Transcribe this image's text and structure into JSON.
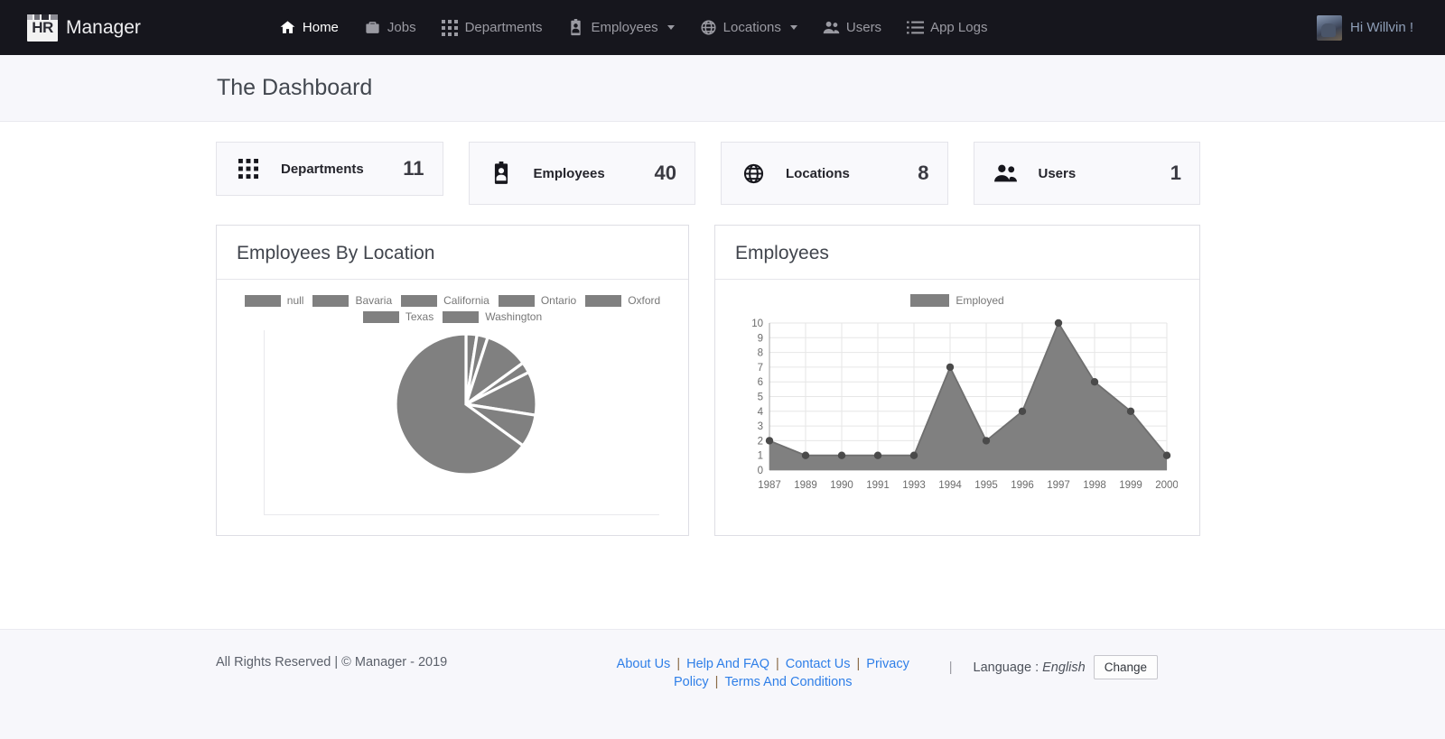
{
  "navbar": {
    "brand_logo_text": "HR",
    "brand_name": "Manager",
    "items": [
      {
        "label": "Home",
        "icon": "home-icon",
        "active": true,
        "caret": false
      },
      {
        "label": "Jobs",
        "icon": "briefcase-icon",
        "active": false,
        "caret": false
      },
      {
        "label": "Departments",
        "icon": "grid-icon",
        "active": false,
        "caret": false
      },
      {
        "label": "Employees",
        "icon": "id-badge-icon",
        "active": false,
        "caret": true
      },
      {
        "label": "Locations",
        "icon": "globe-icon",
        "active": false,
        "caret": true
      },
      {
        "label": "Users",
        "icon": "people-icon",
        "active": false,
        "caret": false
      },
      {
        "label": "App Logs",
        "icon": "list-icon",
        "active": false,
        "caret": false
      }
    ],
    "user": {
      "greeting": "Hi Willvin !",
      "avatar": "user-avatar-photo"
    }
  },
  "page": {
    "title": "The Dashboard"
  },
  "stats": [
    {
      "label": "Departments",
      "value": "11",
      "icon": "grid-icon"
    },
    {
      "label": "Employees",
      "value": "40",
      "icon": "id-badge-icon"
    },
    {
      "label": "Locations",
      "value": "8",
      "icon": "globe-icon"
    },
    {
      "label": "Users",
      "value": "1",
      "icon": "people-icon"
    }
  ],
  "cards": {
    "pie_title": "Employees By Location",
    "line_title": "Employees"
  },
  "chart_data": [
    {
      "type": "pie",
      "title": "Employees By Location",
      "legend_position": "top",
      "series_color": "#808080",
      "labels": [
        "null",
        "Bavaria",
        "California",
        "Ontario",
        "Oxford",
        "Texas",
        "Washington"
      ],
      "values": [
        26,
        1,
        1,
        4,
        1,
        4,
        3
      ],
      "total": 40
    },
    {
      "type": "area",
      "title": "Employees",
      "legend": [
        "Employed"
      ],
      "legend_position": "top",
      "series_color": "#808080",
      "xlabel": "",
      "ylabel": "",
      "grid": true,
      "ylim": [
        0,
        10
      ],
      "yticks": [
        0,
        1,
        2,
        3,
        4,
        5,
        6,
        7,
        8,
        9,
        10
      ],
      "categories": [
        "1987",
        "1989",
        "1990",
        "1991",
        "1993",
        "1994",
        "1995",
        "1996",
        "1997",
        "1998",
        "1999",
        "2000"
      ],
      "series": [
        {
          "name": "Employed",
          "values": [
            2,
            1,
            1,
            1,
            1,
            7,
            2,
            4,
            10,
            6,
            4,
            1
          ]
        }
      ]
    }
  ],
  "footer": {
    "copyright": "All Rights Reserved | © Manager - 2019",
    "links": [
      "About Us",
      "Help And FAQ",
      "Contact Us",
      "Privacy Policy",
      "Terms And Conditions"
    ],
    "separator": "|",
    "language_label": "Language :",
    "language_value": "English",
    "change_label": "Change"
  }
}
